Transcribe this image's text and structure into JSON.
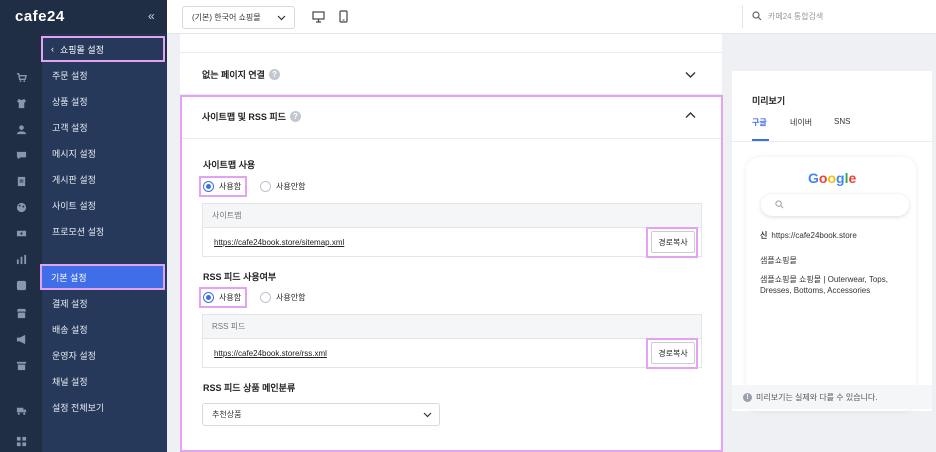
{
  "brand": {
    "logo": "cafe24",
    "collapse_icon": "«"
  },
  "topbar": {
    "shop_select": "(기본) 한국어 쇼핑몰",
    "search_placeholder": "카페24 통합검색"
  },
  "sidebar": {
    "back_label": "쇼핑몰 설정",
    "items": [
      {
        "label": "주문 설정"
      },
      {
        "label": "상품 설정"
      },
      {
        "label": "고객 설정"
      },
      {
        "label": "메시지 설정"
      },
      {
        "label": "게시판 설정"
      },
      {
        "label": "사이트 설정"
      },
      {
        "label": "프로모션 설정"
      },
      {
        "label": "기본 설정"
      },
      {
        "label": "결제 설정"
      },
      {
        "label": "배송 설정"
      },
      {
        "label": "운영자 설정"
      },
      {
        "label": "채널 설정"
      },
      {
        "label": "설정 전체보기"
      }
    ]
  },
  "main": {
    "section_404": "없는 페이지 연결",
    "section_sitemap": "사이트맵 및 RSS 피드",
    "sitemap": {
      "label": "사이트맵 사용",
      "use": "사용함",
      "not_use": "사용안함",
      "field_label": "사이트맵",
      "url": "https://cafe24book.store/sitemap.xml",
      "copy": "경로복사"
    },
    "rss": {
      "label": "RSS 피드 사용여부",
      "use": "사용함",
      "not_use": "사용안함",
      "field_label": "RSS 피드",
      "url": "https://cafe24book.store/rss.xml",
      "copy": "경로복사"
    },
    "rss_category": {
      "label": "RSS 피드 상품 메인분류",
      "value": "추천상품"
    }
  },
  "preview": {
    "title": "미리보기",
    "tabs": [
      "구글",
      "네이버",
      "SNS"
    ],
    "google_logo": "Google",
    "site_icon_text": "신",
    "site_url": "https://cafe24book.store",
    "site_name": "샘플쇼핑몰",
    "desc_line1": "샘플쇼핑몰 쇼핑몰 | Outerwear, Tops,",
    "desc_line2": "Dresses, Bottoms, Accessories",
    "note": "미리보기는 실제와 다를 수 있습니다."
  },
  "colors": {
    "sidebar_dark": "#1f2d45",
    "sidebar": "#27395a",
    "accent": "#3f6ee8",
    "highlight": "#e4a3f2"
  }
}
